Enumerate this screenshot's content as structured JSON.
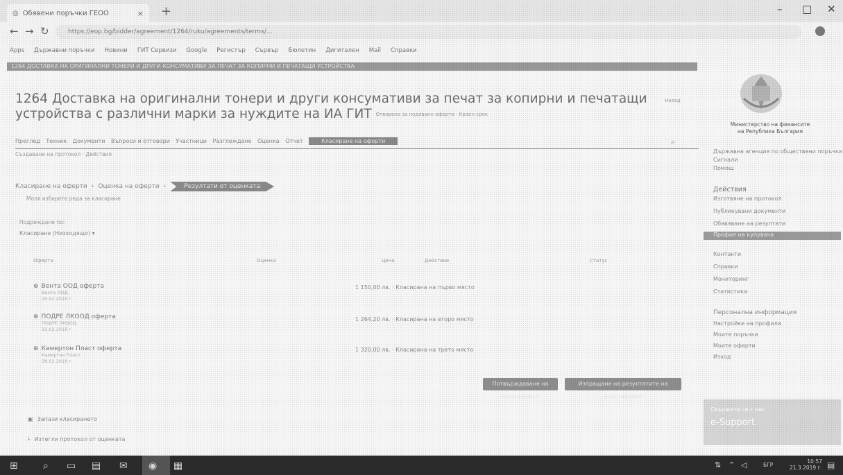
{
  "browser": {
    "tab_title": "Обявени поръчки ГЕОО",
    "tab_close": "×",
    "new_tab": "+",
    "url": "https://eop.bg/bidder/agreement/1264/ruku/agreements/terms/...",
    "bookmarks": [
      "Apps",
      "Държавни поръчки",
      "Новини",
      "ГИТ Сервизи",
      "Google",
      "Регистър",
      "Сървър",
      "Бюлетин",
      "Дигитален",
      "Mail",
      "Справки"
    ],
    "controls": {
      "minimize": "–",
      "maximize": "□",
      "close": "✕"
    }
  },
  "page": {
    "banner": "1264 ДОСТАВКА НА ОРИГИНАЛНИ ТОНЕРИ И ДРУГИ КОНСУМАТИВИ ЗА ПЕЧАТ ЗА КОПИРНИ И ПЕЧАТАЩИ УСТРОЙСТВА",
    "title": "1264 Доставка на оригинални тонери и други консумативи за печат за копирни и печатащи устройства с различни марки за нуждите на ИА ГИТ",
    "title_sub": "Отворена за подаване оферти · Краен срок",
    "title_link": "Назад",
    "tabs": [
      "Преглед",
      "Техник",
      "Документи",
      "Въпроси и отговори",
      "Участници",
      "Разглеждане",
      "Оценка",
      "Отчет",
      "Класиране на оферти"
    ],
    "subnav": "Създаване на протокол · Действия",
    "steps": [
      "Класиране на оферти",
      "Оценка на оферти",
      "Резултати от оценката"
    ],
    "note": "Моля изберете реда за класиране",
    "sort_label": "Подреждане по:",
    "sort_value": "Класиране (Низходящо) ▾",
    "table_headers": [
      "Оферта",
      "Оценка",
      "Цена",
      "Действие",
      "Статус"
    ],
    "rows": [
      {
        "name": "Вента ООД оферта",
        "meta1": "Вента ООД",
        "meta2": "25.02.2019 г.",
        "value": "1 150,00 лв.",
        "status": "Класирана на първо място"
      },
      {
        "name": "ПОДРЕ ЛКООД оферта",
        "meta1": "ПОДРЕ ЛКООД",
        "meta2": "22.02.2019 г.",
        "value": "1 264,20 лв.",
        "status": "Класирана на второ място"
      },
      {
        "name": "Камертон Пласт оферта",
        "meta1": "Камертон Пласт",
        "meta2": "28.02.2019 г.",
        "value": "1 320,00 лв.",
        "status": "Класирана на трето място"
      }
    ],
    "buttons": {
      "primary": "Потвърждаване на класирането",
      "secondary": "Изпращане на резултатите на участниците"
    },
    "footer_links": [
      "Запази класирането",
      "Изтегли протокол от оценката"
    ]
  },
  "sidebar": {
    "ministry": [
      "Министерство на финансите",
      "на Република България"
    ],
    "top_items": [
      "Държавна агенция по обществени поръчки",
      "Сигнали",
      "Помощ"
    ],
    "section": "Действия",
    "items": [
      "Изготвяне на протокол",
      "Публикувани документи",
      "Обявяване на резултати",
      "Профил на купувача",
      "Контакти",
      "Справки",
      "Мониторинг",
      "Статистика"
    ],
    "extra": [
      "Персонална информация",
      "Настройки на профила",
      "Моите поръчки",
      "Моите оферти",
      "Изход"
    ],
    "promo_title": "Свържете се с нас",
    "promo_body": "e-Support"
  },
  "taskbar": {
    "lang": "БГР",
    "time": "10:57",
    "date": "21.3.2019 г."
  }
}
